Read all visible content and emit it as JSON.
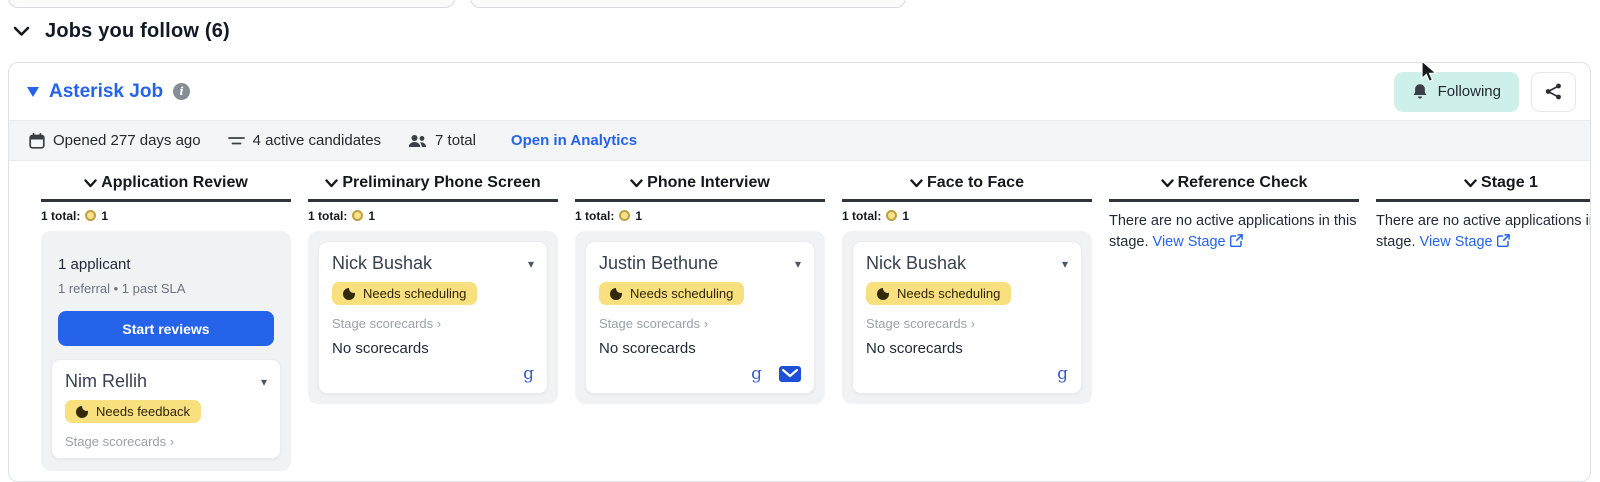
{
  "header": {
    "section_title": "Jobs you follow (6)"
  },
  "panel": {
    "title": "Asterisk Job",
    "following_button": "Following",
    "meta": {
      "opened": "Opened 277 days ago",
      "active_candidates": "4 active candidates",
      "total": "7 total",
      "analytics_link": "Open in Analytics"
    }
  },
  "stages": [
    {
      "name": "Application Review",
      "total_label": "1 total:",
      "total_count": "1",
      "summary": {
        "applicants": "1 applicant",
        "details": "1 referral • 1 past SLA",
        "action": "Start reviews"
      },
      "candidate": {
        "name": "Nim Rellih",
        "badge": "Needs feedback",
        "scorecards": "Stage scorecards ›"
      }
    },
    {
      "name": "Preliminary Phone Screen",
      "total_label": "1 total:",
      "total_count": "1",
      "candidate": {
        "name": "Nick Bushak",
        "badge": "Needs scheduling",
        "scorecards": "Stage scorecards ›",
        "no_scorecards": "No scorecards"
      }
    },
    {
      "name": "Phone Interview",
      "total_label": "1 total:",
      "total_count": "1",
      "candidate": {
        "name": "Justin Bethune",
        "badge": "Needs scheduling",
        "scorecards": "Stage scorecards ›",
        "no_scorecards": "No scorecards"
      }
    },
    {
      "name": "Face to Face",
      "total_label": "1 total:",
      "total_count": "1",
      "candidate": {
        "name": "Nick Bushak",
        "badge": "Needs scheduling",
        "scorecards": "Stage scorecards ›",
        "no_scorecards": "No scorecards"
      }
    },
    {
      "name": "Reference Check",
      "empty_text": "There are no active applications in this stage.",
      "view_stage": "View Stage"
    },
    {
      "name": "Stage 1",
      "empty_text": "There are no active applications in this stage.",
      "view_stage": "View Stage"
    }
  ],
  "colors": {
    "accent_blue": "#2563eb",
    "badge_yellow": "#f9e07e",
    "following_teal": "#cdf0eb",
    "stage_gray": "#f1f2f4"
  }
}
